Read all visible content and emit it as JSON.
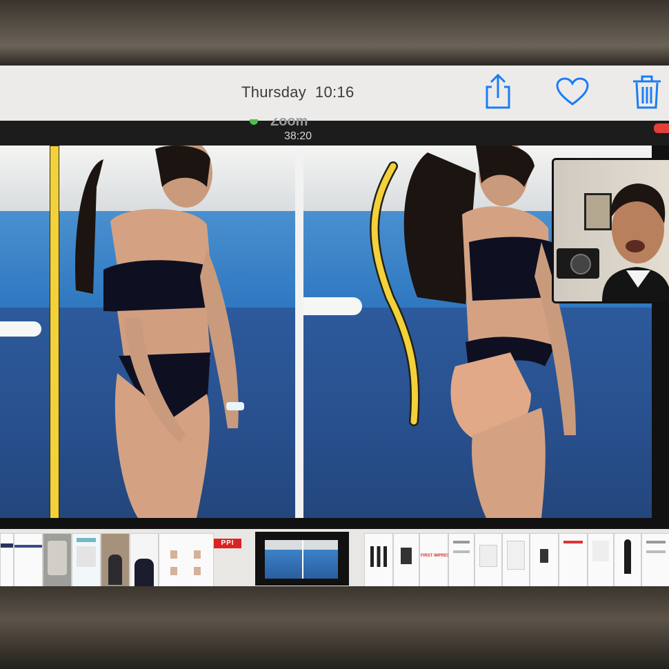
{
  "photos_app": {
    "header": {
      "date_time": "Thursday  10:16",
      "share_icon": "share-icon",
      "favorite_icon": "heart-icon",
      "delete_icon": "trash-icon",
      "accent_color": "#1a7cf5"
    }
  },
  "zoom": {
    "title": "Zoom",
    "timer": "38:20",
    "recording_color": "#e2403a"
  },
  "shared_content": {
    "filmstrip": {
      "badge": "PPI",
      "label_red": "FIRST IMPRESSION"
    }
  }
}
